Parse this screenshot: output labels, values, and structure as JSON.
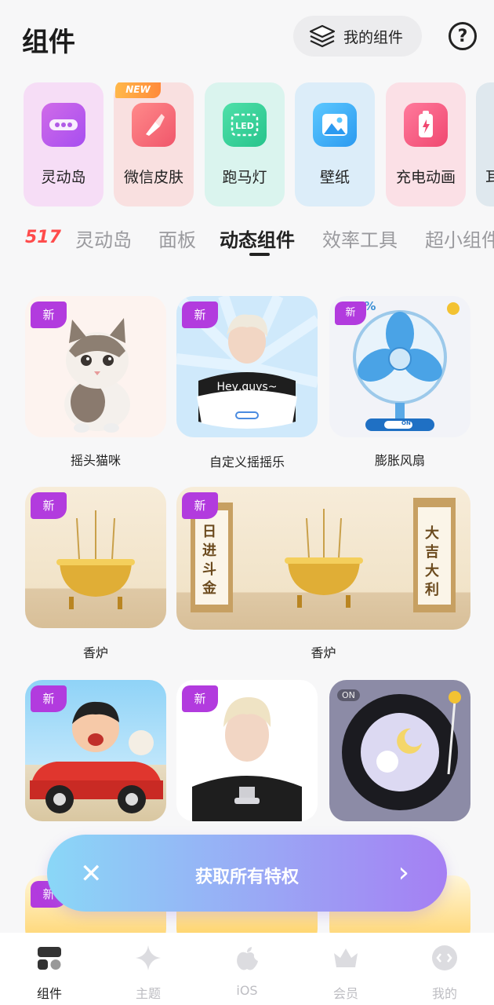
{
  "header": {
    "title": "组件",
    "my_widgets_label": "我的组件",
    "help_label": "?"
  },
  "categories": [
    {
      "label": "灵动岛",
      "icon": "dynamic-island-icon",
      "bg": "#f6ddf6"
    },
    {
      "label": "微信皮肤",
      "icon": "brush-icon",
      "bg": "#f9e0e0",
      "badge": "NEW"
    },
    {
      "label": "跑马灯",
      "icon": "led-icon",
      "bg": "#daf4ee"
    },
    {
      "label": "壁纸",
      "icon": "image-icon",
      "bg": "#dcedf9"
    },
    {
      "label": "充电动画",
      "icon": "battery-icon",
      "bg": "#fbe0e6"
    },
    {
      "label": "耳",
      "icon": "earphone-icon",
      "bg": "#dfe8ee"
    }
  ],
  "tabs": {
    "logo": "517",
    "items": [
      "灵动岛",
      "面板",
      "动态组件",
      "效率工具",
      "超小组件"
    ],
    "active": "动态组件"
  },
  "cards": {
    "new_tag": "新",
    "row1": [
      {
        "title": "摇头猫咪"
      },
      {
        "title": "自定义摇摇乐",
        "overlay": "Hey,guys~"
      },
      {
        "title": "膨胀风扇",
        "percent": "0%",
        "switch": "ON"
      }
    ],
    "row2": [
      {
        "title": "香炉"
      },
      {
        "title": "香炉",
        "scroll_left": "日进斗金",
        "scroll_right": "大吉大利"
      }
    ],
    "row3": [
      {
        "title": ""
      },
      {
        "title": ""
      },
      {
        "title": "",
        "switch": "ON"
      }
    ]
  },
  "promo": {
    "label": "获取所有特权",
    "close": "✕",
    "arrow": "›"
  },
  "bottom_nav": [
    {
      "label": "组件",
      "icon": "widgets-icon",
      "active": true
    },
    {
      "label": "主题",
      "icon": "sparkle-icon"
    },
    {
      "label": "iOS",
      "icon": "apple-icon"
    },
    {
      "label": "会员",
      "icon": "crown-icon"
    },
    {
      "label": "我的",
      "icon": "profile-icon"
    }
  ]
}
